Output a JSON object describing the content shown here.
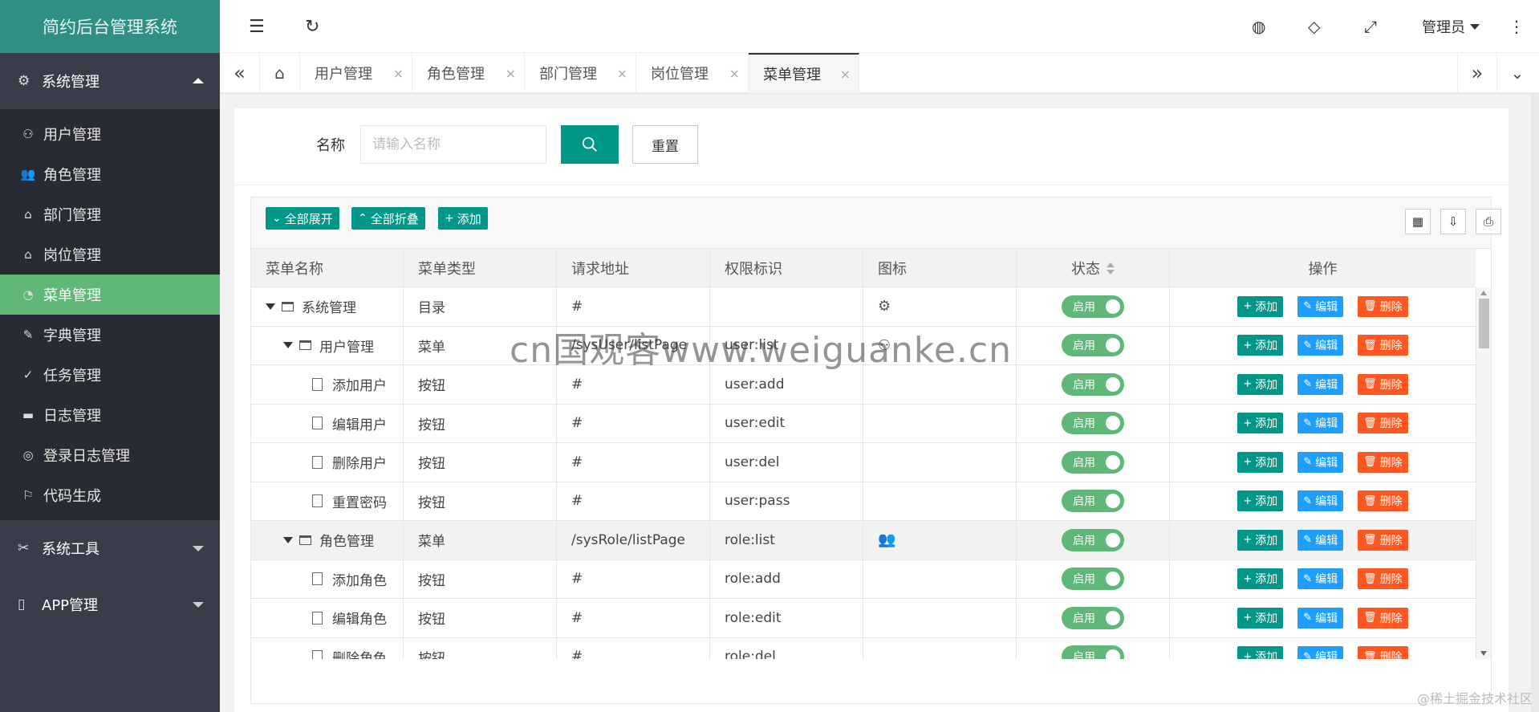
{
  "app": {
    "title": "简约后台管理系统"
  },
  "sidebar": {
    "group_system": "系统管理",
    "items": [
      {
        "label": "用户管理",
        "icon": "user-icon"
      },
      {
        "label": "角色管理",
        "icon": "users-icon"
      },
      {
        "label": "部门管理",
        "icon": "home-icon"
      },
      {
        "label": "岗位管理",
        "icon": "home-icon"
      },
      {
        "label": "菜单管理",
        "icon": "dashboard-icon"
      },
      {
        "label": "字典管理",
        "icon": "pencil-icon"
      },
      {
        "label": "任务管理",
        "icon": "check-circle-icon"
      },
      {
        "label": "日志管理",
        "icon": "log-icon"
      },
      {
        "label": "登录日志管理",
        "icon": "location-icon"
      },
      {
        "label": "代码生成",
        "icon": "flag-icon"
      }
    ],
    "group_tools": "系统工具",
    "group_app": "APP管理"
  },
  "header": {
    "user": "管理员"
  },
  "tabs": [
    {
      "label": "用户管理"
    },
    {
      "label": "角色管理"
    },
    {
      "label": "部门管理"
    },
    {
      "label": "岗位管理"
    },
    {
      "label": "菜单管理"
    }
  ],
  "search": {
    "label": "名称",
    "placeholder": "请输入名称",
    "reset": "重置"
  },
  "toolbar": {
    "expand": "全部展开",
    "collapse": "全部折叠",
    "add": "添加"
  },
  "table": {
    "columns": [
      "菜单名称",
      "菜单类型",
      "请求地址",
      "权限标识",
      "图标",
      "状态",
      "操作"
    ],
    "rows": [
      {
        "name": "系统管理",
        "type": "目录",
        "url": "#",
        "perm": "",
        "icon": "gear",
        "status": "启用"
      },
      {
        "name": "用户管理",
        "type": "菜单",
        "url": "/sysUser/listPage",
        "perm": "user:list",
        "icon": "user",
        "status": "启用"
      },
      {
        "name": "添加用户",
        "type": "按钮",
        "url": "#",
        "perm": "user:add",
        "icon": "",
        "status": "启用"
      },
      {
        "name": "编辑用户",
        "type": "按钮",
        "url": "#",
        "perm": "user:edit",
        "icon": "",
        "status": "启用"
      },
      {
        "name": "删除用户",
        "type": "按钮",
        "url": "#",
        "perm": "user:del",
        "icon": "",
        "status": "启用"
      },
      {
        "name": "重置密码",
        "type": "按钮",
        "url": "#",
        "perm": "user:pass",
        "icon": "",
        "status": "启用"
      },
      {
        "name": "角色管理",
        "type": "菜单",
        "url": "/sysRole/listPage",
        "perm": "role:list",
        "icon": "users",
        "status": "启用"
      },
      {
        "name": "添加角色",
        "type": "按钮",
        "url": "#",
        "perm": "role:add",
        "icon": "",
        "status": "启用"
      },
      {
        "name": "编辑角色",
        "type": "按钮",
        "url": "#",
        "perm": "role:edit",
        "icon": "",
        "status": "启用"
      },
      {
        "name": "删除角色",
        "type": "按钮",
        "url": "#",
        "perm": "role:del",
        "icon": "",
        "status": "启用"
      }
    ],
    "actions": {
      "add": "添加",
      "edit": "编辑",
      "del": "删除"
    }
  },
  "watermark": "cn国观客www.weiguanke.cn",
  "footer_mark": "@稀土掘金技术社区",
  "colors": {
    "primary": "#009688",
    "sidebar": "#393d49",
    "active": "#5fb878",
    "edit": "#1e9fff",
    "delete": "#ff5722"
  }
}
